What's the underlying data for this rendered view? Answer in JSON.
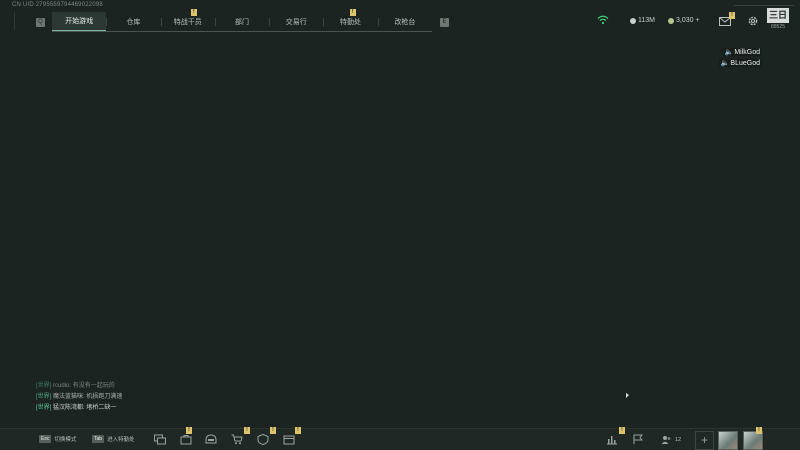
{
  "uid": "CN UID 2795559794469022098",
  "nav": {
    "left_key": "Q",
    "right_key": "E",
    "tabs": [
      {
        "label": "开始游戏",
        "active": true,
        "badge": ""
      },
      {
        "label": "仓库",
        "active": false,
        "badge": ""
      },
      {
        "label": "特战干员",
        "active": false,
        "badge": "!"
      },
      {
        "label": "部门",
        "active": false,
        "badge": ""
      },
      {
        "label": "交易行",
        "active": false,
        "badge": ""
      },
      {
        "label": "特勤处",
        "active": false,
        "badge": "!"
      },
      {
        "label": "改枪台",
        "active": false,
        "badge": ""
      }
    ]
  },
  "currency": {
    "silver": "113M",
    "gold": "3,030",
    "gold_plus": "+",
    "silver_color": "#c9d0cc",
    "gold_color": "#b8c78e"
  },
  "mail_badge": "!",
  "rank": {
    "label": "三日",
    "number": "88525"
  },
  "voice_users": [
    "MilkGod",
    "BLueGod"
  ],
  "chat": [
    {
      "channel": "[世界]",
      "user": "rcudio",
      "text": "有没有一起玩的"
    },
    {
      "channel": "[世界]",
      "user": "魔法蓝猫咪",
      "text": "机损跑刀满速"
    },
    {
      "channel": "[世界]",
      "user": "猛汉陈湾都",
      "text": "堵桥二缺一"
    }
  ],
  "bottom": {
    "switch_key": "Esc",
    "switch_label": "切换模式",
    "enter_key": "Tab",
    "enter_label": "进入特勤处",
    "friends_count": "12",
    "badge": "!"
  },
  "colors": {
    "accent": "#7fb59f",
    "badge": "#e0c46c",
    "chat_tag": "#5ec79a",
    "wifi": "#3fd07a"
  }
}
